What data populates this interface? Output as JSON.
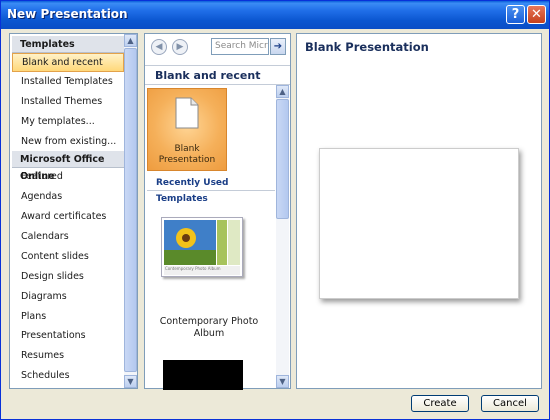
{
  "window": {
    "title": "New Presentation",
    "help_label": "?",
    "close_label": "✕"
  },
  "left": {
    "sections": [
      {
        "header": "Templates",
        "items": [
          "Blank and recent",
          "Installed Templates",
          "Installed Themes",
          "My templates...",
          "New from existing..."
        ]
      },
      {
        "header": "Microsoft Office Online",
        "items": [
          "Featured",
          "Agendas",
          "Award certificates",
          "Calendars",
          "Content slides",
          "Design slides",
          "Diagrams",
          "Plans",
          "Presentations",
          "Resumes",
          "Schedules"
        ]
      }
    ],
    "selected_item": "Blank and recent"
  },
  "middle": {
    "search_placeholder": "Search Micro",
    "back_icon": "back-arrow-icon",
    "forward_icon": "forward-arrow-icon",
    "go_icon": "go-arrow-icon",
    "heading": "Blank and recent",
    "tile_label_1": "Blank",
    "tile_label_2": "Presentation",
    "recent_heading": "Recently Used Templates",
    "thumb_text": "Contemporary Photo Album",
    "thumb_caption_1": "Contemporary Photo",
    "thumb_caption_2": "Album"
  },
  "preview": {
    "title": "Blank Presentation"
  },
  "buttons": {
    "create": "Create",
    "cancel": "Cancel"
  },
  "colors": {
    "titlebar": "#0b56d0",
    "selection": "#ffd87a",
    "tile": "#f5b05a"
  }
}
